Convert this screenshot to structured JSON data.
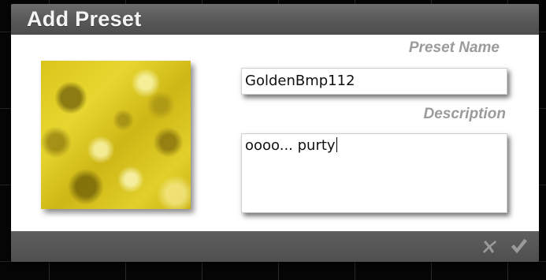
{
  "dialog": {
    "title": "Add Preset",
    "preset_name_label": "Preset Name",
    "preset_name_value": "GoldenBmp112",
    "description_label": "Description",
    "description_value": "oooo... purty"
  },
  "footer": {
    "cancel_icon": "close-x-icon",
    "confirm_icon": "checkmark-icon"
  },
  "colors": {
    "title_bar": "#5b5b5b",
    "label_text": "#9b9b9b",
    "swatch_gold": "#d9c41a"
  }
}
